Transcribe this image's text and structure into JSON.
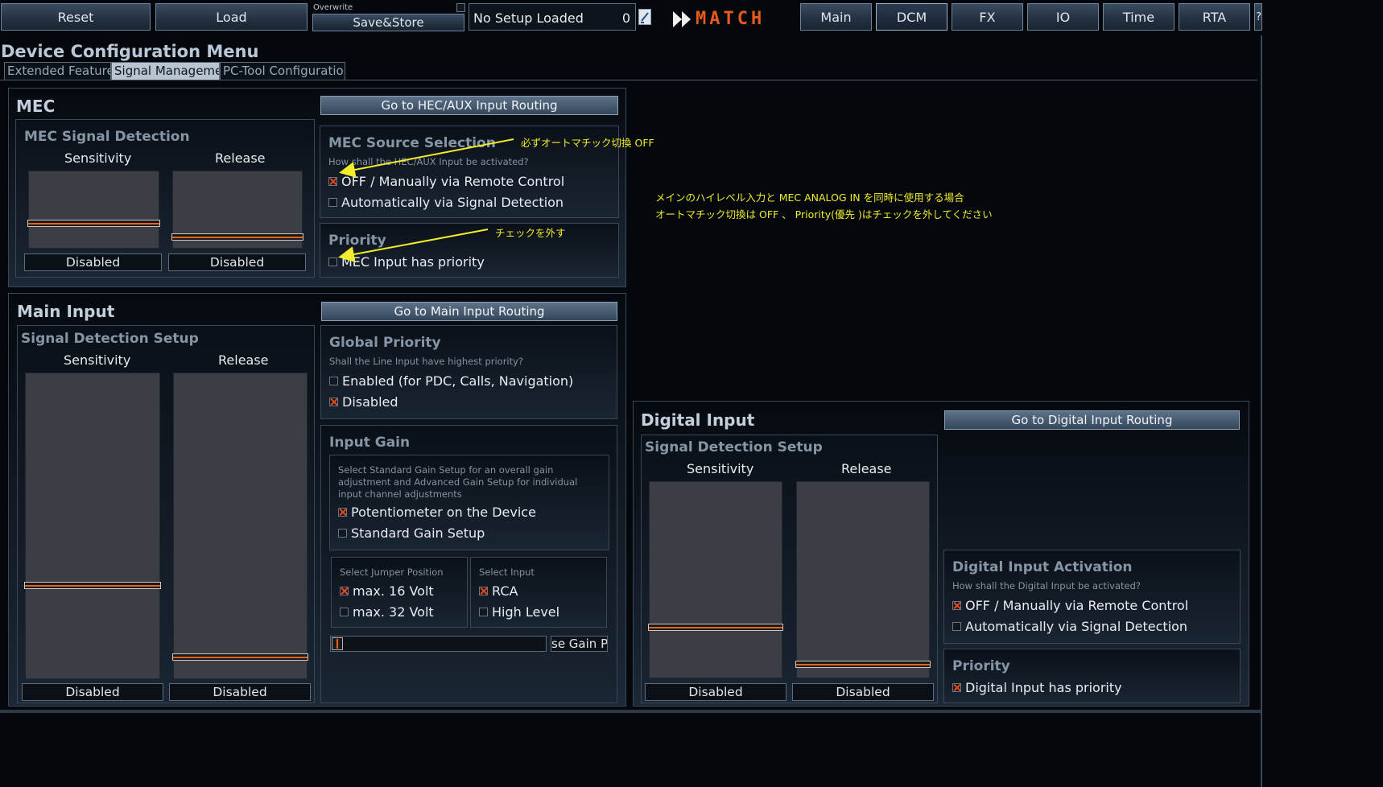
{
  "toolbar": {
    "reset": "Reset",
    "load": "Load",
    "overwrite_label": "Overwrite",
    "save_store": "Save&Store",
    "setup_name": "No Setup Loaded",
    "setup_number": "0",
    "logo_text": "MATCH",
    "tabs": [
      "Main",
      "DCM",
      "FX",
      "IO",
      "Time",
      "RTA"
    ],
    "help": "?"
  },
  "page": {
    "title": "Device Configuration Menu",
    "tabs": [
      "Extended Features",
      "Signal Management",
      "PC-Tool Configuration"
    ]
  },
  "mec": {
    "title": "MEC",
    "route_button": "Go to HEC/AUX Input Routing",
    "signal_detection": {
      "title": "MEC Signal Detection",
      "sensitivity_label": "Sensitivity",
      "release_label": "Release",
      "sensitivity_value": "Disabled",
      "release_value": "Disabled",
      "sensitivity_level": 0.3,
      "release_level": 0.1
    },
    "source_selection": {
      "title": "MEC Source Selection",
      "hint": "How shall the HEC/AUX Input be activated?",
      "options": [
        "OFF / Manually via Remote Control",
        "Automatically via Signal Detection"
      ]
    },
    "priority": {
      "title": "Priority",
      "option": "MEC Input has priority"
    }
  },
  "main_input": {
    "title": "Main Input",
    "route_button": "Go to Main Input Routing",
    "signal_detection": {
      "title": "Signal Detection Setup",
      "sensitivity_label": "Sensitivity",
      "release_label": "Release",
      "sensitivity_value": "Disabled",
      "release_value": "Disabled",
      "sensitivity_level": 0.3,
      "release_level": 0.06
    },
    "global_priority": {
      "title": "Global Priority",
      "hint": "Shall the Line Input have highest priority?",
      "options": [
        "Enabled (for PDC, Calls, Navigation)",
        "Disabled"
      ]
    },
    "input_gain": {
      "title": "Input Gain",
      "hint": "Select Standard Gain Setup for an overall gain adjustment and Advanced Gain Setup for individual input channel adjustments",
      "options": [
        "Potentiometer on the Device",
        "Standard Gain Setup"
      ],
      "jumper_title": "Select Jumper Position",
      "jumper_options": [
        "max. 16 Volt",
        "max. 32 Volt"
      ],
      "input_title": "Select Input",
      "input_options": [
        "RCA",
        "High Level"
      ],
      "gain_button": "se Gain Po"
    }
  },
  "digital_input": {
    "title": "Digital Input",
    "route_button": "Go to Digital Input Routing",
    "signal_detection": {
      "title": "Signal Detection Setup",
      "sensitivity_label": "Sensitivity",
      "release_label": "Release",
      "sensitivity_value": "Disabled",
      "release_value": "Disabled",
      "sensitivity_level": 0.25,
      "release_level": 0.05
    },
    "activation": {
      "title": "Digital Input Activation",
      "hint": "How shall the Digital Input be activated?",
      "options": [
        "OFF / Manually via Remote Control",
        "Automatically via Signal Detection"
      ]
    },
    "priority": {
      "title": "Priority",
      "option": "Digital Input has priority"
    }
  },
  "annotations": {
    "arrow1": "必ずオートマチック切換 OFF",
    "arrow2": "チェックを外す",
    "note_line1": "メインのハイレベル入力と MEC ANALOG IN を同時に使用する場合",
    "note_line2": "オートマチック切換は OFF 、 Priority(優先 )はチェックを外してください"
  },
  "colors": {
    "accent": "#e8621c",
    "annotation": "#f2ec2a",
    "check": "#e8491c"
  }
}
